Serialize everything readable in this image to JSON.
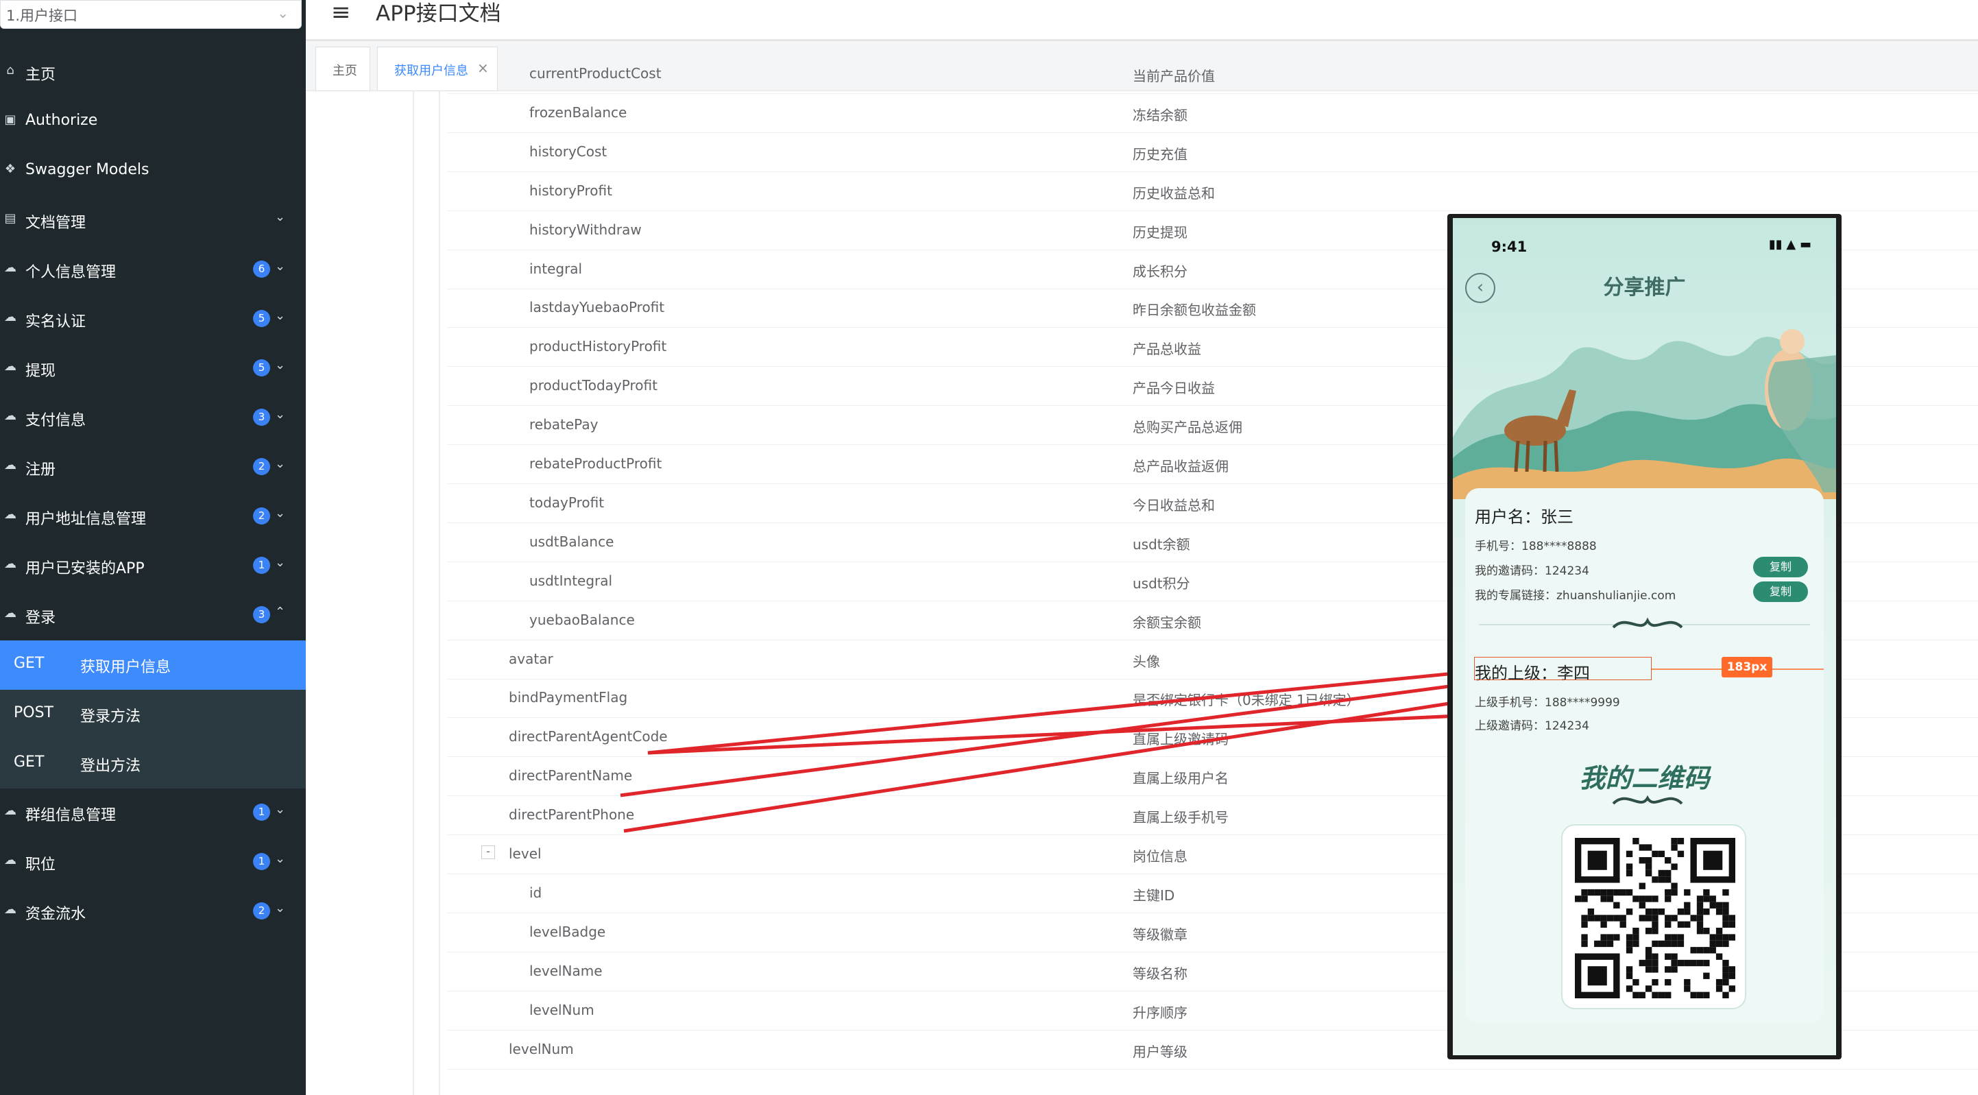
{
  "sidebar": {
    "group_select": "1.用户接口",
    "items": [
      {
        "label": "主页"
      },
      {
        "label": "Authorize"
      },
      {
        "label": "Swagger Models"
      },
      {
        "label": "文档管理"
      },
      {
        "label": "个人信息管理",
        "badge": "6"
      },
      {
        "label": "实名认证",
        "badge": "5"
      },
      {
        "label": "提现",
        "badge": "5"
      },
      {
        "label": "支付信息",
        "badge": "3"
      },
      {
        "label": "注册",
        "badge": "2"
      },
      {
        "label": "用户地址信息管理",
        "badge": "2"
      },
      {
        "label": "用户已安装的APP",
        "badge": "1"
      },
      {
        "label": "登录",
        "badge": "3"
      },
      {
        "label": "群组信息管理",
        "badge": "1"
      },
      {
        "label": "职位",
        "badge": "1"
      },
      {
        "label": "资金流水",
        "badge": "2"
      }
    ],
    "sub_items": [
      {
        "method": "GET",
        "label": "获取用户信息"
      },
      {
        "method": "POST",
        "label": "登录方法"
      },
      {
        "method": "GET",
        "label": "登出方法"
      }
    ]
  },
  "header": {
    "title": "APP接口文档"
  },
  "tabs": [
    {
      "label": "主页"
    },
    {
      "label": "获取用户信息"
    }
  ],
  "table": {
    "rows": [
      {
        "name": "currentProductCost",
        "desc": "当前产品价值"
      },
      {
        "name": "frozenBalance",
        "desc": "冻结余额"
      },
      {
        "name": "historyCost",
        "desc": "历史充值"
      },
      {
        "name": "historyProfit",
        "desc": "历史收益总和"
      },
      {
        "name": "historyWithdraw",
        "desc": "历史提现"
      },
      {
        "name": "integral",
        "desc": "成长积分"
      },
      {
        "name": "lastdayYuebaoProfit",
        "desc": "昨日余额包收益金额"
      },
      {
        "name": "productHistoryProfit",
        "desc": "产品总收益"
      },
      {
        "name": "productTodayProfit",
        "desc": "产品今日收益"
      },
      {
        "name": "rebatePay",
        "desc": "总购买产品总返佣"
      },
      {
        "name": "rebateProductProfit",
        "desc": "总产品收益返佣"
      },
      {
        "name": "todayProfit",
        "desc": "今日收益总和"
      },
      {
        "name": "usdtBalance",
        "desc": "usdt余额"
      },
      {
        "name": "usdtIntegral",
        "desc": "usdt积分"
      },
      {
        "name": "yuebaoBalance",
        "desc": "余额宝余额"
      },
      {
        "name": "avatar",
        "desc": "头像"
      },
      {
        "name": "bindPaymentFlag",
        "desc": "是否绑定银行卡（0未绑定 1已绑定）"
      },
      {
        "name": "directParentAgentCode",
        "desc": "直属上级邀请码"
      },
      {
        "name": "directParentName",
        "desc": "直属上级用户名"
      },
      {
        "name": "directParentPhone",
        "desc": "直属上级手机号"
      },
      {
        "name": "level",
        "desc": "岗位信息",
        "toggle": "-"
      },
      {
        "name": "id",
        "desc": "主键ID"
      },
      {
        "name": "levelBadge",
        "desc": "等级徽章"
      },
      {
        "name": "levelName",
        "desc": "等级名称"
      },
      {
        "name": "levelNum",
        "desc": "升序顺序"
      },
      {
        "name": "levelNum",
        "desc": "用户等级"
      }
    ]
  },
  "phone": {
    "time": "9:41",
    "title": "分享推广",
    "username_line": "用户名：张三",
    "phone_line": "手机号：188****8888",
    "invite_line": "我的邀请码：124234",
    "link_line": "我的专属链接：zhuanshulianjie.com",
    "copy_label": "复制",
    "parent_title": "我的上级：李四",
    "parent_phone": "上级手机号：188****9999",
    "parent_invite": "上级邀请码：124234",
    "px_badge": "183px",
    "qr_title": "我的二维码"
  },
  "colors": {
    "sidebar_bg": "#1e282d",
    "active_item": "#3d8bfd",
    "badge": "#3b82f6",
    "arrow": "#e0252b"
  }
}
